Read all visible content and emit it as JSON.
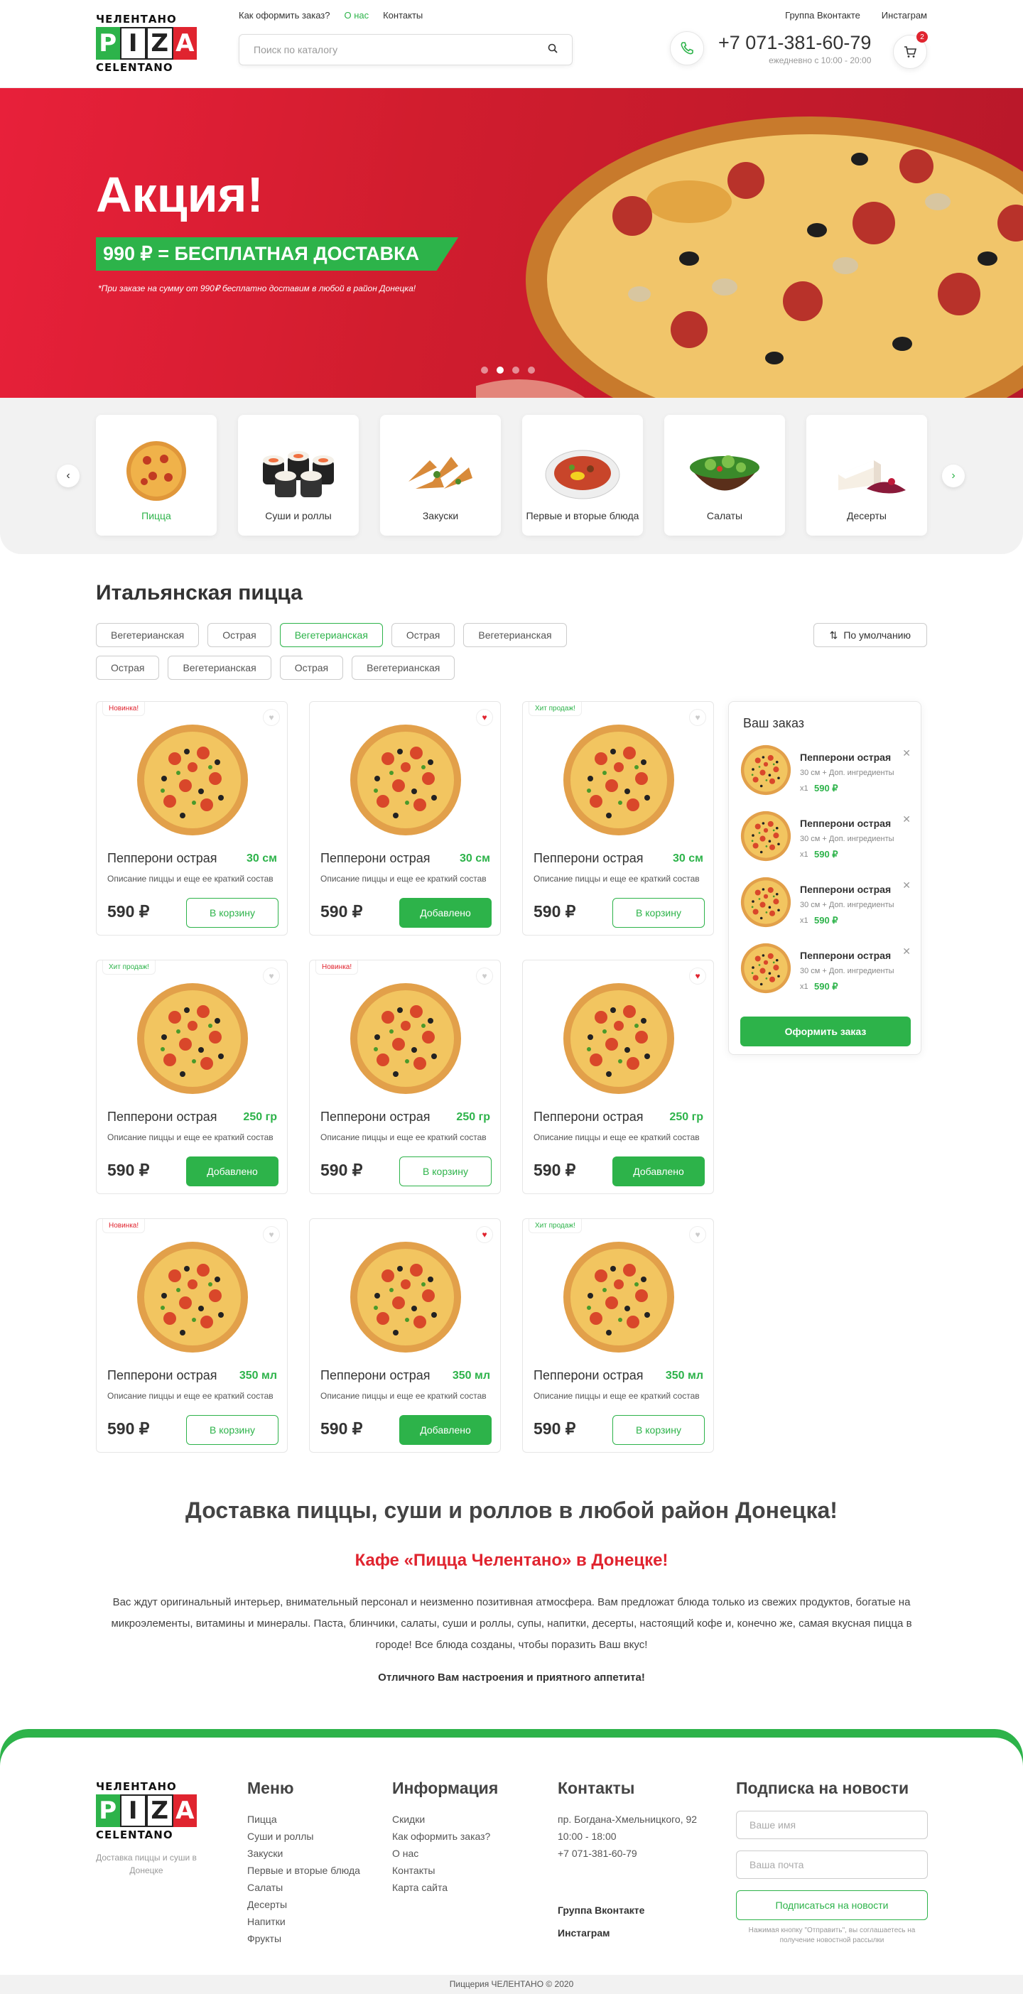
{
  "header": {
    "logo_top": "ЧЕЛЕНТАНО",
    "logo_mid": "PIZZA",
    "logo_bottom": "CELENTANO",
    "nav": [
      "Как оформить заказ?",
      "О нас",
      "Контакты"
    ],
    "nav_active": 1,
    "right_links": [
      "Группа Вконтакте",
      "Инстаграм"
    ],
    "search_placeholder": "Поиск по каталогу",
    "phone": "+7 071-381-60-79",
    "hours": "ежедневно с 10:00 - 20:00",
    "cart_count": "2"
  },
  "hero": {
    "title": "Акция!",
    "promo": "990 ₽ = БЕСПЛАТНАЯ ДОСТАВКА",
    "note": "*При заказе на сумму от 990₽ бесплатно доставим в любой в район Донецка!",
    "active_slide": 1,
    "slides": 4
  },
  "categories": [
    {
      "label": "Пицца",
      "icon": "pizza-icon",
      "active": true
    },
    {
      "label": "Суши и роллы",
      "icon": "sushi-icon"
    },
    {
      "label": "Закуски",
      "icon": "snacks-icon"
    },
    {
      "label": "Первые и вторые блюда",
      "icon": "soup-icon"
    },
    {
      "label": "Салаты",
      "icon": "salad-icon"
    },
    {
      "label": "Десерты",
      "icon": "dessert-icon"
    }
  ],
  "catalog": {
    "title": "Итальянская пицца",
    "filters": [
      "Вегетерианская",
      "Острая",
      "Вегетерианская",
      "Острая",
      "Вегетерианская",
      "Острая",
      "Вегетерианская",
      "Острая",
      "Вегетерианская"
    ],
    "filter_active": 2,
    "sort": "По умолчанию",
    "products": [
      {
        "tag": "Новинка!",
        "tag_color": "red",
        "liked": false,
        "name": "Пепперони острая",
        "size": "30 см",
        "desc": "Описание пиццы и еще ее краткий состав",
        "price": "590 ₽",
        "button": "В корзину",
        "added": false
      },
      {
        "tag": "",
        "liked": true,
        "name": "Пепперони острая",
        "size": "30 см",
        "desc": "Описание пиццы и еще ее краткий состав",
        "price": "590 ₽",
        "button": "Добавлено",
        "added": true
      },
      {
        "tag": "Хит продаж!",
        "tag_color": "green",
        "liked": false,
        "name": "Пепперони острая",
        "size": "30 см",
        "desc": "Описание пиццы и еще ее краткий состав",
        "price": "590 ₽",
        "button": "В корзину",
        "added": false
      },
      {
        "tag": "Хит продаж!",
        "tag_color": "green",
        "liked": false,
        "name": "Пепперони острая",
        "size": "250 гр",
        "desc": "Описание пиццы и еще ее краткий состав",
        "price": "590 ₽",
        "button": "Добавлено",
        "added": true
      },
      {
        "tag": "Новинка!",
        "tag_color": "red",
        "liked": false,
        "name": "Пепперони острая",
        "size": "250 гр",
        "desc": "Описание пиццы и еще ее краткий состав",
        "price": "590 ₽",
        "button": "В корзину",
        "added": false
      },
      {
        "tag": "",
        "liked": true,
        "name": "Пепперони острая",
        "size": "250 гр",
        "desc": "Описание пиццы и еще ее краткий состав",
        "price": "590 ₽",
        "button": "Добавлено",
        "added": true
      },
      {
        "tag": "Новинка!",
        "tag_color": "red",
        "liked": false,
        "name": "Пепперони острая",
        "size": "350 мл",
        "desc": "Описание пиццы и еще ее краткий состав",
        "price": "590 ₽",
        "button": "В корзину",
        "added": false
      },
      {
        "tag": "",
        "liked": true,
        "name": "Пепперони острая",
        "size": "350 мл",
        "desc": "Описание пиццы и еще ее краткий состав",
        "price": "590 ₽",
        "button": "Добавлено",
        "added": true
      },
      {
        "tag": "Хит продаж!",
        "tag_color": "green",
        "liked": false,
        "name": "Пепперони острая",
        "size": "350 мл",
        "desc": "Описание пиццы и еще ее краткий состав",
        "price": "590 ₽",
        "button": "В корзину",
        "added": false
      }
    ]
  },
  "order": {
    "title": "Ваш заказ",
    "items": [
      {
        "name": "Пепперони острая",
        "details": "30 см + Доп. ингредиенты",
        "qty": "x1",
        "price": "590 ₽"
      },
      {
        "name": "Пепперони острая",
        "details": "30 см + Доп. ингредиенты",
        "qty": "x1",
        "price": "590 ₽"
      },
      {
        "name": "Пепперони острая",
        "details": "30 см + Доп. ингредиенты",
        "qty": "x1",
        "price": "590 ₽"
      },
      {
        "name": "Пепперони острая",
        "details": "30 см + Доп. ингредиенты",
        "qty": "x1",
        "price": "590 ₽"
      }
    ],
    "button": "Оформить заказ"
  },
  "about": {
    "title": "Доставка пиццы, суши и роллов в любой район Донецка!",
    "subtitle": "Кафе «Пицца Челентано» в Донецке!",
    "text": "Вас ждут оригинальный интерьер, внимательный персонал и неизменно позитивная атмосфера. Вам предложат блюда только из свежих продуктов, богатые на микроэлементы, витамины и минералы. Паста, блинчики, салаты, суши  и роллы, супы, напитки, десерты, настоящий кофе и, конечно же, самая вкусная пицца в городе! Все блюда созданы, чтобы поразить Ваш вкус!",
    "thanks": "Отличного Вам настроения и приятного аппетита!"
  },
  "footer": {
    "caption": "Доставка пиццы и суши в Донецке",
    "menu_title": "Меню",
    "menu": [
      "Пицца",
      "Суши и роллы",
      "Закуски",
      "Первые и вторые блюда",
      "Салаты",
      "Десерты",
      "Напитки",
      "Фрукты"
    ],
    "info_title": "Информация",
    "info": [
      "Скидки",
      "Как оформить заказ?",
      "О нас",
      "Контакты",
      "Карта сайта"
    ],
    "contacts_title": "Контакты",
    "contacts": [
      "пр. Богдана-Хмельницкого, 92",
      "10:00 - 18:00",
      "+7 071-381-60-79"
    ],
    "social": [
      "Группа Вконтакте",
      "Инстаграм"
    ],
    "subscribe_title": "Подписка на новости",
    "name_placeholder": "Ваше имя",
    "email_placeholder": "Ваша почта",
    "subscribe_button": "Подписаться на новости",
    "subscribe_note": "Нажимая кнопку \"Отправить\", вы соглашаетесь на получение новостной рассылки",
    "copyright": "Пиццерия ЧЕЛЕНТАНО © 2020"
  }
}
